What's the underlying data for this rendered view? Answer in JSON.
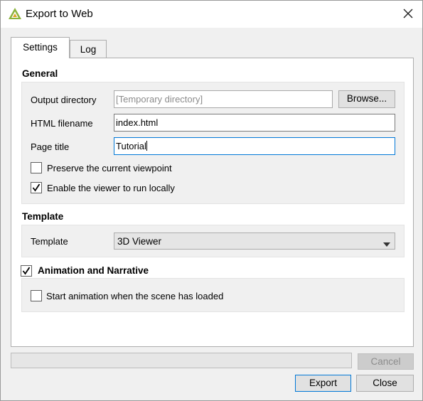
{
  "window": {
    "title": "Export to Web",
    "icon": "qgis-logo-icon",
    "close_icon": "close-icon"
  },
  "tabs": [
    {
      "label": "Settings",
      "active": true
    },
    {
      "label": "Log",
      "active": false
    }
  ],
  "general": {
    "title": "General",
    "output_directory": {
      "label": "Output directory",
      "value": "",
      "placeholder": "[Temporary directory]"
    },
    "browse_label": "Browse...",
    "html_filename": {
      "label": "HTML filename",
      "value": "index.html"
    },
    "page_title": {
      "label": "Page title",
      "value": "Tutorial"
    },
    "preserve_viewpoint": {
      "label": "Preserve the current viewpoint",
      "checked": false
    },
    "run_locally": {
      "label": "Enable the viewer to run locally",
      "checked": true
    }
  },
  "template": {
    "title": "Template",
    "label": "Template",
    "selected": "3D Viewer"
  },
  "animation": {
    "title": "Animation and Narrative",
    "checked": true,
    "start_on_load": {
      "label": "Start animation when the scene has loaded",
      "checked": false
    }
  },
  "progress": {
    "value": 0
  },
  "buttons": {
    "cancel": "Cancel",
    "export": "Export",
    "close": "Close"
  }
}
